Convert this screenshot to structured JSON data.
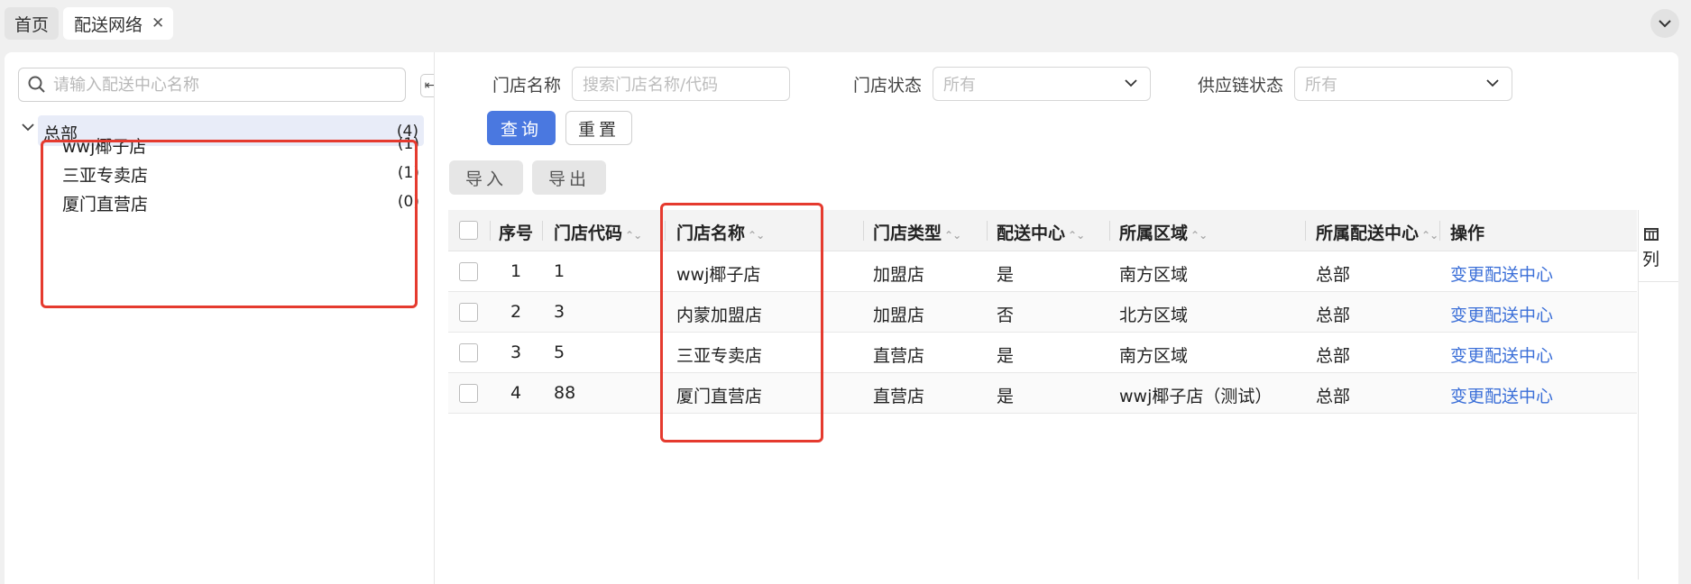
{
  "tabs": {
    "home": "首页",
    "active": "配送网络",
    "close_icon": "close-icon"
  },
  "tree": {
    "search_placeholder": "请输入配送中心名称",
    "toggle_glyph": "⇤",
    "root": {
      "label": "总部",
      "count": "(4)"
    },
    "nodes": [
      {
        "label": "wwj椰子店",
        "count": "(1)"
      },
      {
        "label": "三亚专卖店",
        "count": "(1)"
      },
      {
        "label": "厦门直营店",
        "count": "(0)"
      }
    ]
  },
  "filters": {
    "store_name_label": "门店名称",
    "store_name_placeholder": "搜索门店名称/代码",
    "store_status_label": "门店状态",
    "store_status_value": "所有",
    "supply_status_label": "供应链状态",
    "supply_status_value": "所有",
    "query": "查询",
    "reset": "重置"
  },
  "toolbar": {
    "import": "导入",
    "export": "导出"
  },
  "table": {
    "columns": [
      "序号",
      "门店代码",
      "门店名称",
      "门店类型",
      "配送中心",
      "所属区域",
      "所属配送中心",
      "操作"
    ],
    "sort_glyph": "⌃⌄",
    "column_setting": "列",
    "rows": [
      {
        "idx": "1",
        "code": "1",
        "name": "wwj椰子店",
        "type": "加盟店",
        "dc": "是",
        "region": "南方区域",
        "parent": "总部",
        "action": "变更配送中心"
      },
      {
        "idx": "2",
        "code": "3",
        "name": "内蒙加盟店",
        "type": "加盟店",
        "dc": "否",
        "region": "北方区域",
        "parent": "总部",
        "action": "变更配送中心"
      },
      {
        "idx": "3",
        "code": "5",
        "name": "三亚专卖店",
        "type": "直营店",
        "dc": "是",
        "region": "南方区域",
        "parent": "总部",
        "action": "变更配送中心"
      },
      {
        "idx": "4",
        "code": "88",
        "name": "厦门直营店",
        "type": "直营店",
        "dc": "是",
        "region": "wwj椰子店（测试）",
        "parent": "总部",
        "action": "变更配送中心"
      }
    ]
  },
  "colors": {
    "primary": "#4a78e0",
    "link": "#3b6fd8",
    "highlight": "#e53a2e"
  }
}
